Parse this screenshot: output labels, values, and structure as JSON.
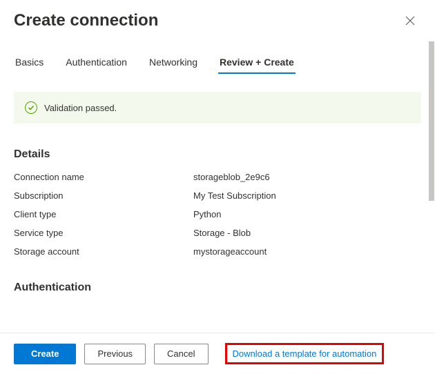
{
  "title": "Create connection",
  "tabs": [
    {
      "label": "Basics",
      "active": false
    },
    {
      "label": "Authentication",
      "active": false
    },
    {
      "label": "Networking",
      "active": false
    },
    {
      "label": "Review + Create",
      "active": true
    }
  ],
  "validation": {
    "message": "Validation passed."
  },
  "sections": {
    "details": {
      "heading": "Details",
      "items": [
        {
          "label": "Connection name",
          "value": "storageblob_2e9c6"
        },
        {
          "label": "Subscription",
          "value": "My Test Subscription"
        },
        {
          "label": "Client type",
          "value": "Python"
        },
        {
          "label": "Service type",
          "value": "Storage - Blob"
        },
        {
          "label": "Storage account",
          "value": "mystorageaccount"
        }
      ]
    },
    "authentication": {
      "heading": "Authentication"
    }
  },
  "footer": {
    "create": "Create",
    "previous": "Previous",
    "cancel": "Cancel",
    "download": "Download a template for automation"
  }
}
